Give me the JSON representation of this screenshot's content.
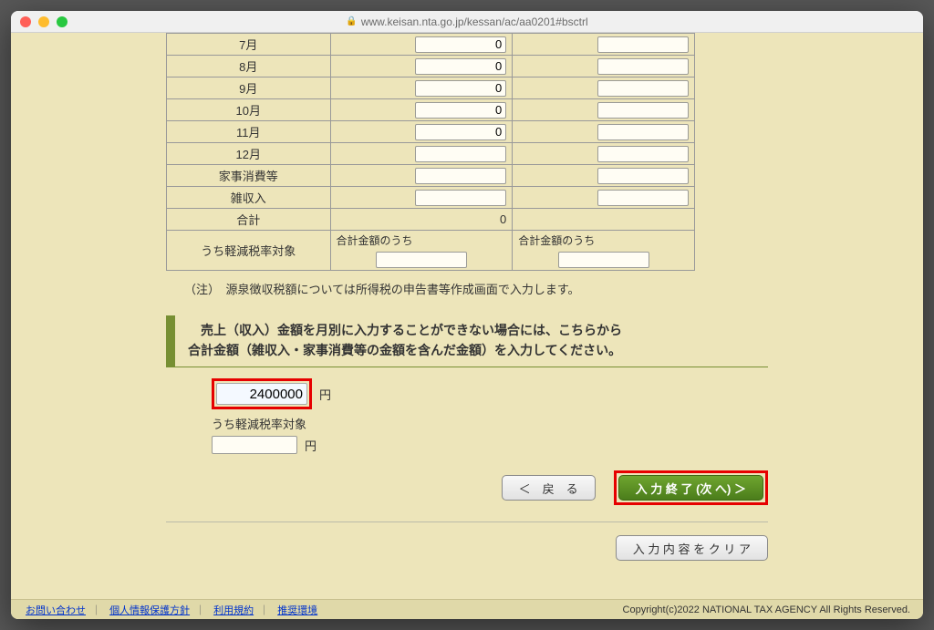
{
  "browser": {
    "url": "www.keisan.nta.go.jp/kessan/ac/aa0201#bsctrl"
  },
  "table": {
    "months": [
      {
        "label": "7月",
        "value": "0"
      },
      {
        "label": "8月",
        "value": "0"
      },
      {
        "label": "9月",
        "value": "0"
      },
      {
        "label": "10月",
        "value": "0"
      },
      {
        "label": "11月",
        "value": "0"
      },
      {
        "label": "12月",
        "value": ""
      }
    ],
    "rows_other": [
      {
        "label": "家事消費等"
      },
      {
        "label": "雑収入"
      }
    ],
    "total_label": "合計",
    "total_value": "0",
    "sub_tax_label": "うち軽減税率対象",
    "sub_total_label": "合計金額のうち"
  },
  "note": "（注）　源泉徴収税額については所得税の申告書等作成画面で入力します。",
  "section": {
    "line1": "　売上（収入）金額を月別に入力することができない場合には、こちらから",
    "line2": "合計金額（雑収入・家事消費等の金額を含んだ金額）を入力してください。"
  },
  "amount": {
    "value": "2400000",
    "unit": "円",
    "sub_tax_label": "うち軽減税率対象",
    "sub_unit": "円"
  },
  "buttons": {
    "back": "＜　戻　る",
    "next": "入 力 終 了 (次 へ) ＞",
    "clear": "入 力 内 容 を ク リ ア"
  },
  "footer": {
    "links": [
      "お問い合わせ",
      "個人情報保護方針",
      "利用規約",
      "推奨環境"
    ],
    "copyright": "Copyright(c)2022 NATIONAL TAX AGENCY All Rights Reserved."
  }
}
